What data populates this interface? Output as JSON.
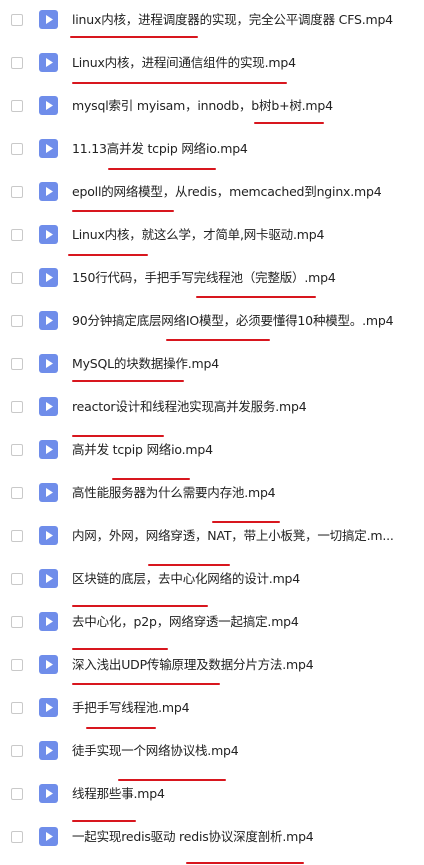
{
  "files": [
    {
      "name": "linux内核，进程调度器的实现，完全公平调度器 CFS.mp4"
    },
    {
      "name": "Linux内核，进程间通信组件的实现.mp4"
    },
    {
      "name": "mysql索引 myisam，innodb，b树b+树.mp4"
    },
    {
      "name": "11.13高并发 tcpip 网络io.mp4"
    },
    {
      "name": "epoll的网络模型，从redis，memcached到nginx.mp4"
    },
    {
      "name": "Linux内核，就这么学，才简单,网卡驱动.mp4"
    },
    {
      "name": "150行代码，手把手写完线程池（完整版）.mp4"
    },
    {
      "name": "90分钟搞定底层网络IO模型，必须要懂得10种模型。.mp4"
    },
    {
      "name": "MySQL的块数据操作.mp4"
    },
    {
      "name": "reactor设计和线程池实现高并发服务.mp4"
    },
    {
      "name": "高并发 tcpip 网络io.mp4"
    },
    {
      "name": "高性能服务器为什么需要内存池.mp4"
    },
    {
      "name": "内网，外网，网络穿透，NAT，带上小板凳，一切搞定.m..."
    },
    {
      "name": "区块链的底层，去中心化网络的设计.mp4"
    },
    {
      "name": "去中心化，p2p，网络穿透一起搞定.mp4"
    },
    {
      "name": "深入浅出UDP传输原理及数据分片方法.mp4"
    },
    {
      "name": "手把手写线程池.mp4"
    },
    {
      "name": "徒手实现一个网络协议栈.mp4"
    },
    {
      "name": "线程那些事.mp4"
    },
    {
      "name": "一起实现redis驱动 redis协议深度剖析.mp4"
    }
  ],
  "colors": {
    "file_icon": "#6f8dea",
    "annotation": "#d8161e"
  },
  "icons": {
    "checkbox": "checkbox",
    "file": "video-file-icon"
  }
}
